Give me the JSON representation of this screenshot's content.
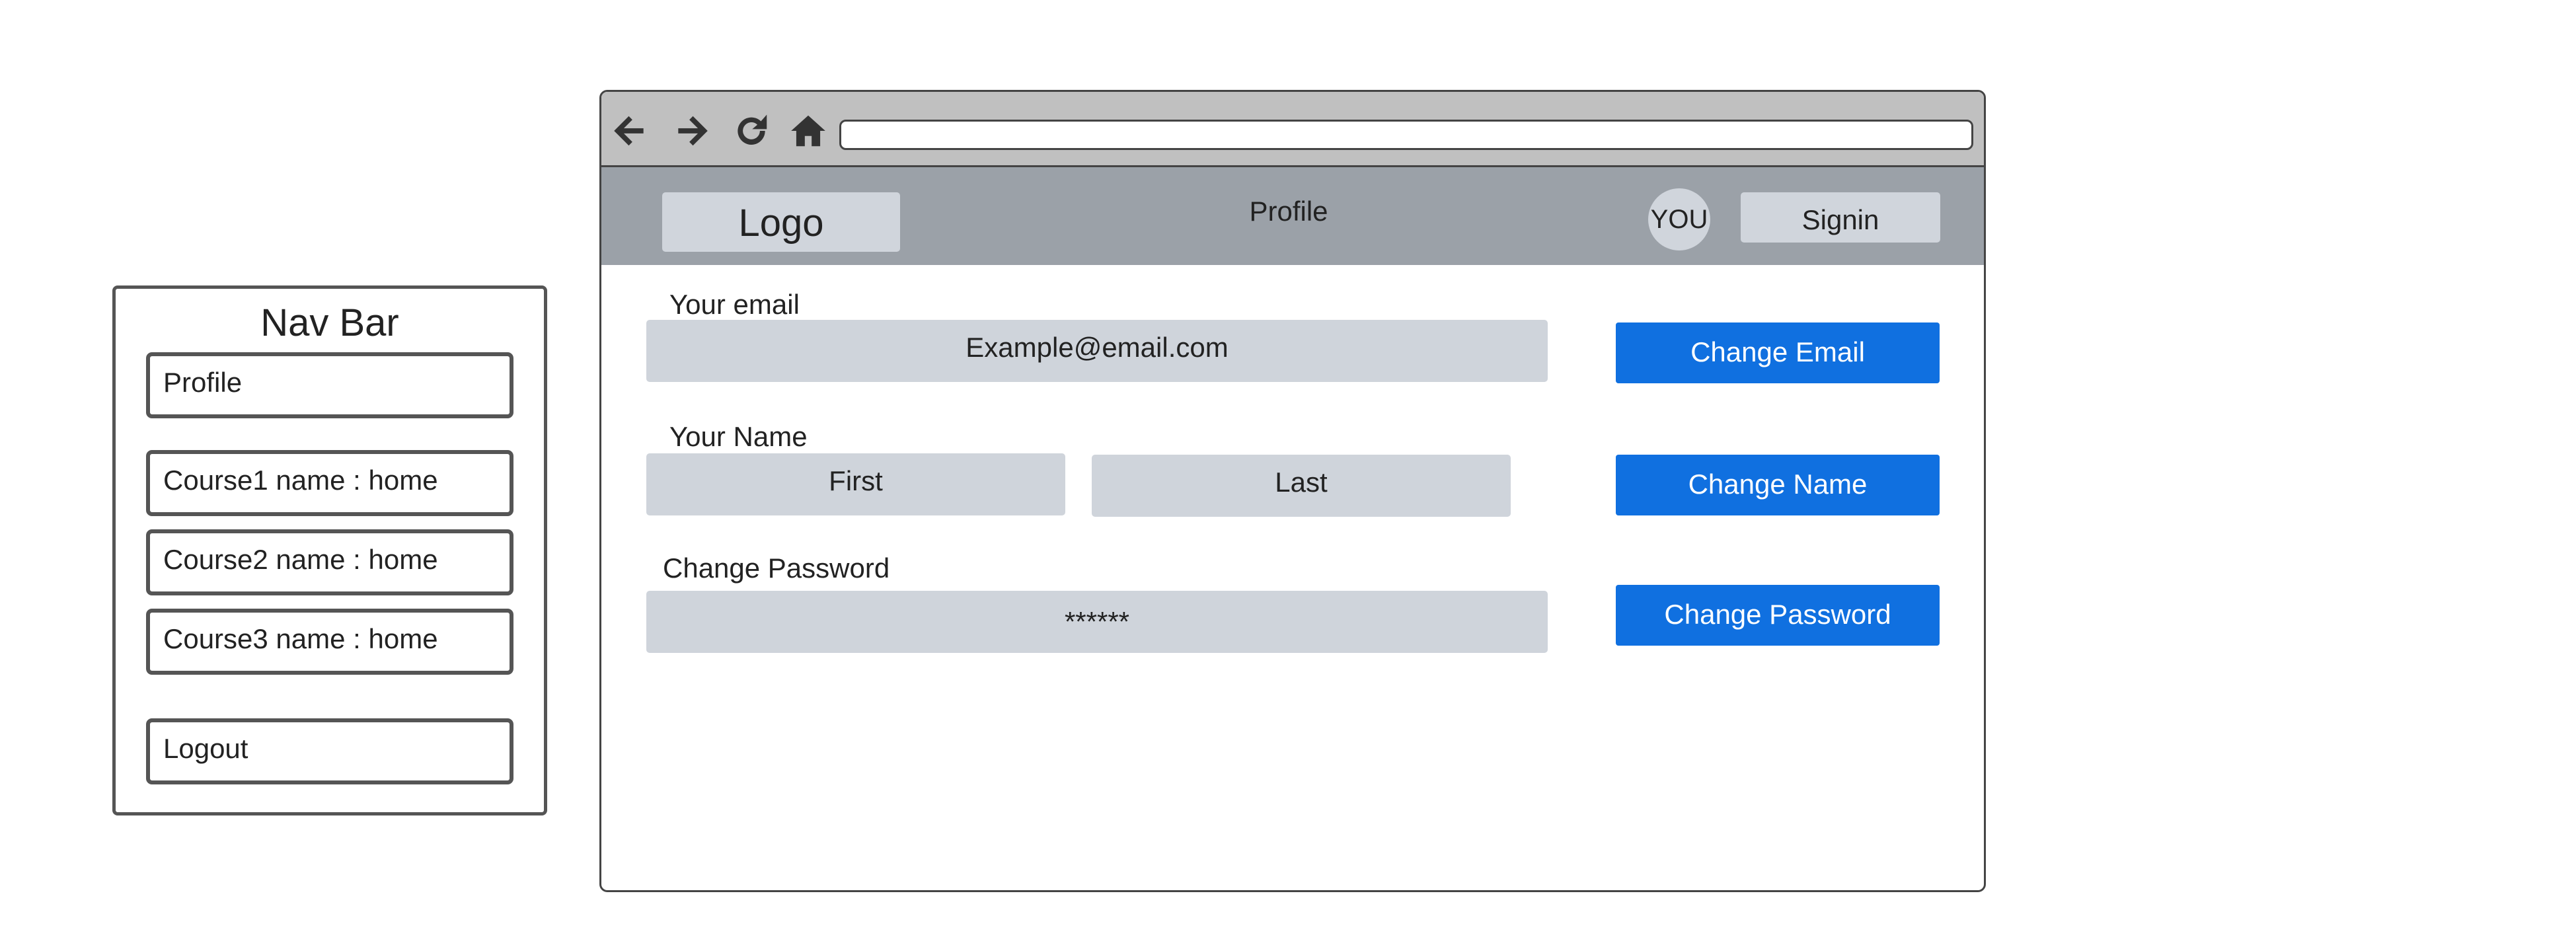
{
  "nav": {
    "title": "Nav Bar",
    "items": [
      {
        "label": "Profile"
      },
      {
        "label": "Course1 name : home"
      },
      {
        "label": "Course2 name : home"
      },
      {
        "label": "Course3 name : home"
      },
      {
        "label": "Logout"
      }
    ]
  },
  "browser": {
    "toolbar": {
      "icons": [
        "back-arrow-icon",
        "forward-arrow-icon",
        "refresh-icon",
        "home-icon"
      ],
      "address": ""
    },
    "header": {
      "logo": "Logo",
      "title": "Profile",
      "avatar": "YOU",
      "signin": "Signin"
    },
    "form": {
      "email": {
        "label": "Your email",
        "value": "Example@email.com",
        "button": "Change Email"
      },
      "name": {
        "label": "Your Name",
        "first": "First",
        "last": "Last",
        "button": "Change Name"
      },
      "password": {
        "label": "Change Password",
        "value": "******",
        "button": "Change Password"
      }
    }
  },
  "colors": {
    "primary_button": "#1070e0",
    "header_bg": "#9ba1a8",
    "field_bg": "#cfd4db",
    "toolbar_bg": "#c0c0c0"
  }
}
